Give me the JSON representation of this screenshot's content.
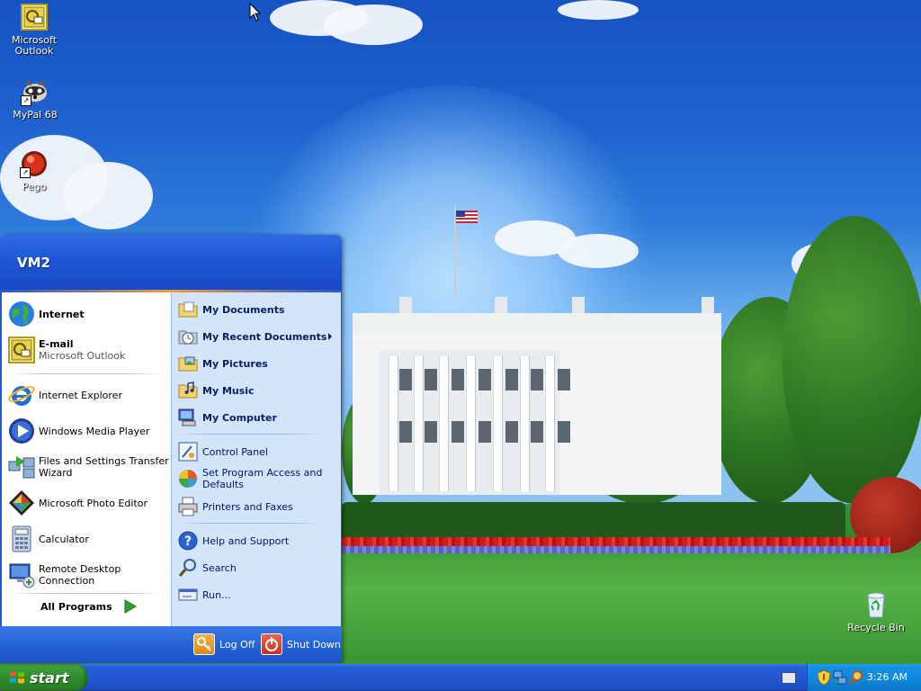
{
  "desktop": {
    "icons": [
      {
        "label_line1": "Microsoft",
        "label_line2": "Outlook"
      },
      {
        "label_line1": "MyPal 68",
        "label_line2": ""
      },
      {
        "label_line1": "Pego",
        "label_line2": ""
      },
      {
        "label_line1": "Recycle Bin",
        "label_line2": ""
      }
    ]
  },
  "start_menu": {
    "user": "VM2",
    "pinned": [
      {
        "title": "Internet",
        "subtitle": ""
      },
      {
        "title": "E-mail",
        "subtitle": "Microsoft Outlook"
      }
    ],
    "recent": [
      {
        "title": "Internet Explorer"
      },
      {
        "title": "Windows Media Player"
      },
      {
        "title": "Files and Settings Transfer",
        "title2": "Wizard"
      },
      {
        "title": "Microsoft Photo Editor"
      },
      {
        "title": "Calculator"
      },
      {
        "title": "Remote Desktop Connection"
      }
    ],
    "all_programs": "All Programs",
    "places": [
      {
        "title": "My Documents"
      },
      {
        "title": "My Recent Documents"
      },
      {
        "title": "My Pictures"
      },
      {
        "title": "My Music"
      },
      {
        "title": "My Computer"
      }
    ],
    "settings": [
      {
        "title": "Control Panel"
      },
      {
        "title": "Set Program Access and",
        "title2": "Defaults"
      },
      {
        "title": "Printers and Faxes"
      }
    ],
    "tools": [
      {
        "title": "Help and Support"
      },
      {
        "title": "Search"
      },
      {
        "title": "Run..."
      }
    ],
    "log_off": "Log Off",
    "shut_down": "Shut Down"
  },
  "taskbar": {
    "start_label": "start",
    "clock": "3:26 AM"
  },
  "icons": {
    "internet": "globe-icon",
    "email": "outlook-icon",
    "ie": "internet-explorer-icon",
    "wmp": "media-player-icon",
    "fast": "transfer-wizard-icon",
    "photo": "photo-editor-icon",
    "calc": "calculator-icon",
    "rdc": "remote-desktop-icon"
  },
  "colors": {
    "start_green": "#2d8a2a",
    "taskbar_blue": "#2357d1",
    "menu_blue": "#1f58d6",
    "right_pane": "#d3e5fa"
  }
}
